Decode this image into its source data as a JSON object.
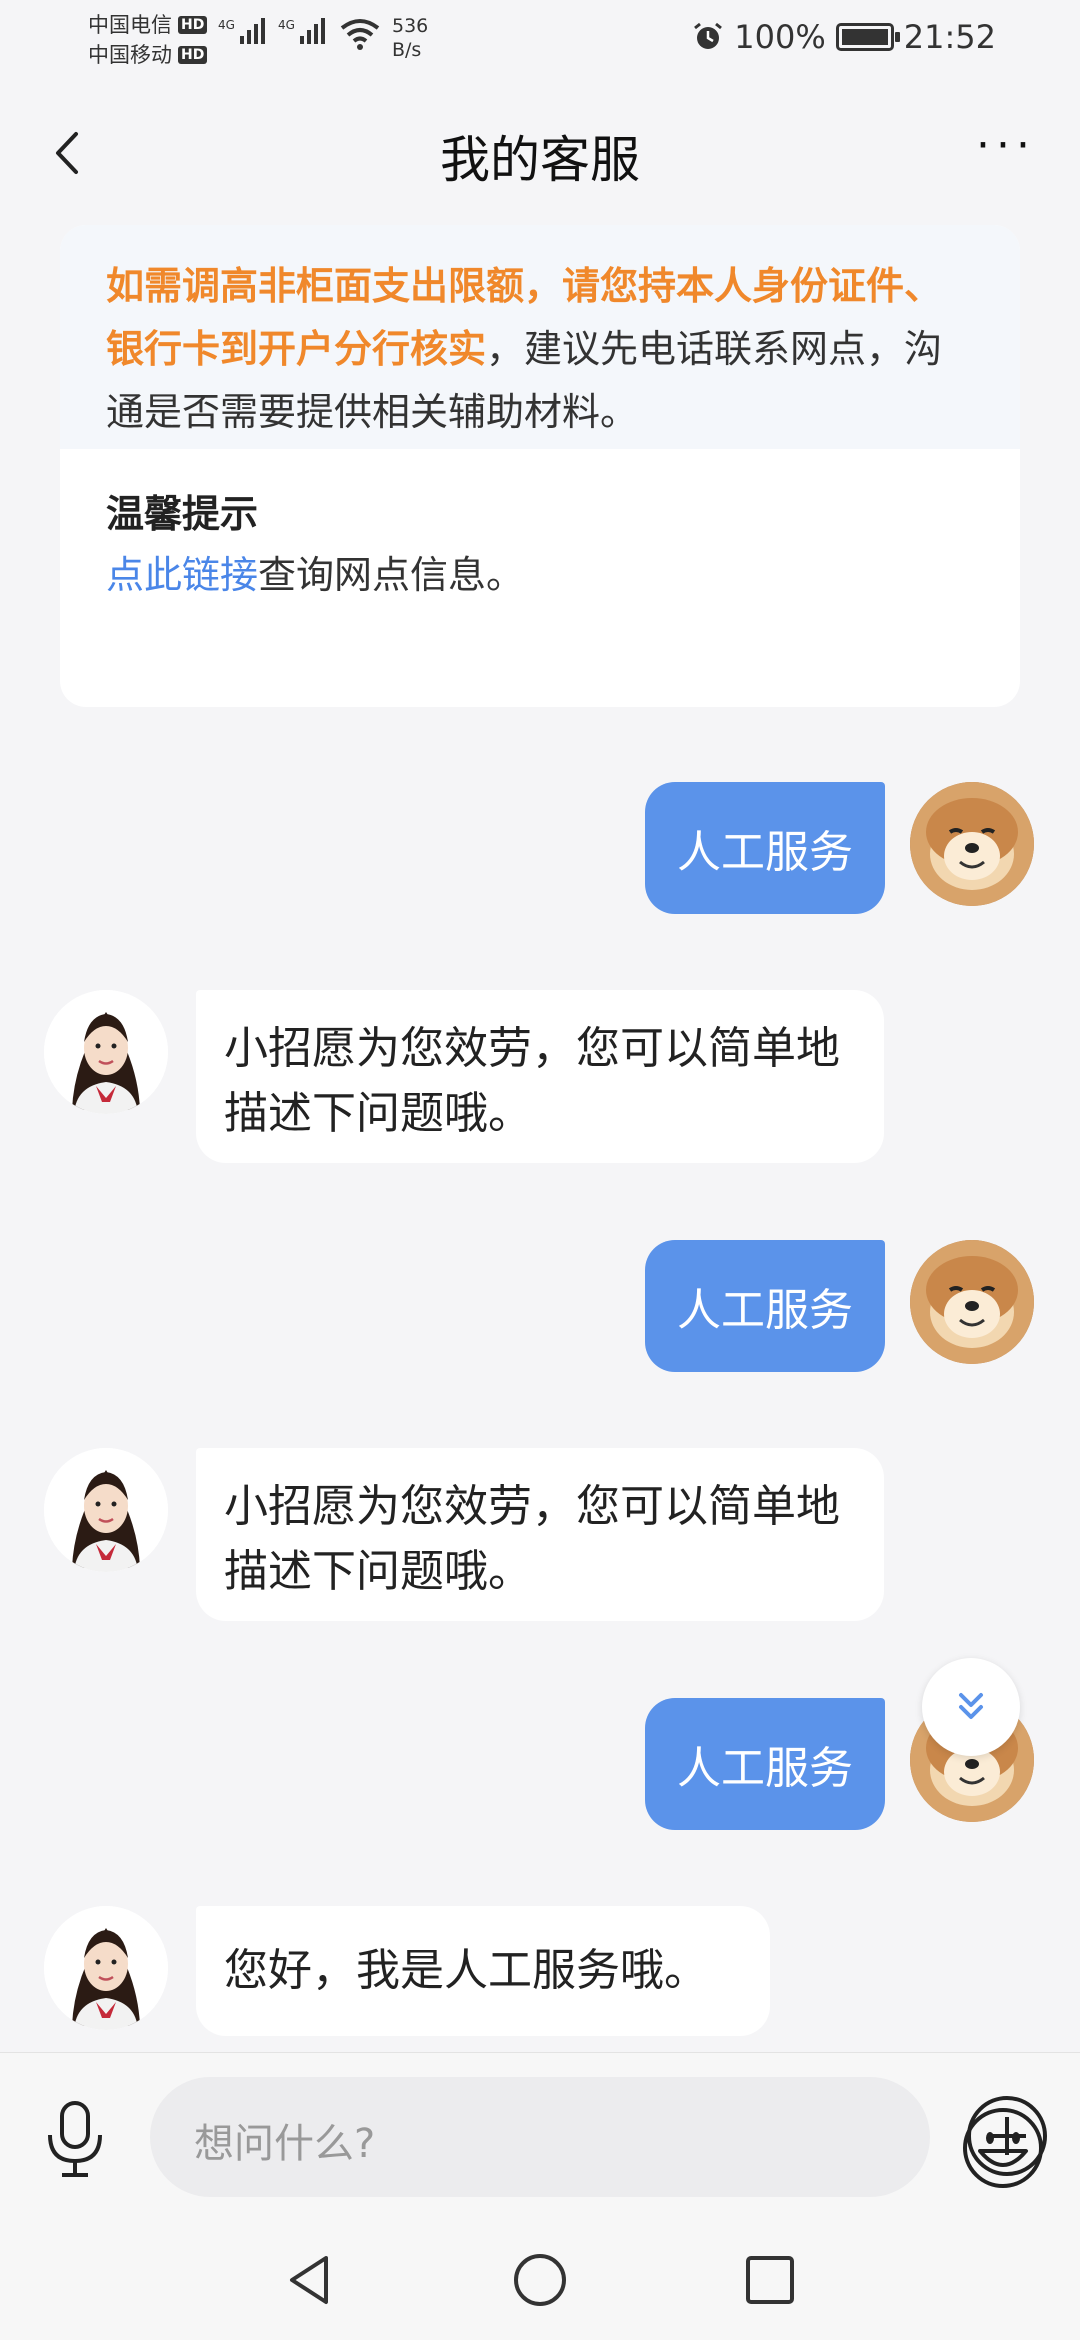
{
  "status": {
    "carrier1": "中国电信",
    "carrier2": "中国移动",
    "hd": "HD",
    "net1": "4G",
    "net2": "4G",
    "speed_value": "536",
    "speed_unit": "B/s",
    "battery": "100%",
    "time": "21:52"
  },
  "header": {
    "title": "我的客服",
    "more": "···"
  },
  "notice": {
    "highlight": "如需调高非柜面支出限额，请您持本人身份证件、银行卡到开户分行核实",
    "rest": "，建议先电话联系网点，沟通是否需要提供相关辅助材料。",
    "tip_title": "温馨提示",
    "tip_link": "点此链接",
    "tip_rest": "查询网点信息。"
  },
  "messages": [
    {
      "from": "user",
      "text": "人工服务"
    },
    {
      "from": "agent",
      "text": "小招愿为您效劳，您可以简单地描述下问题哦。"
    },
    {
      "from": "user",
      "text": "人工服务"
    },
    {
      "from": "agent",
      "text": "小招愿为您效劳，您可以简单地描述下问题哦。"
    },
    {
      "from": "user",
      "text": "人工服务"
    },
    {
      "from": "agent",
      "text": "您好，我是人工服务哦。"
    }
  ],
  "input": {
    "placeholder": "想问什么?"
  },
  "icons": {
    "back": "chevron-left-icon",
    "mic": "microphone-icon",
    "emoji": "smiley-icon",
    "plus": "plus-icon",
    "scroll": "double-chevron-down-icon"
  },
  "colors": {
    "accent_blue": "#5b93ea",
    "highlight_orange": "#f0882b",
    "link_blue": "#4a86e8"
  }
}
